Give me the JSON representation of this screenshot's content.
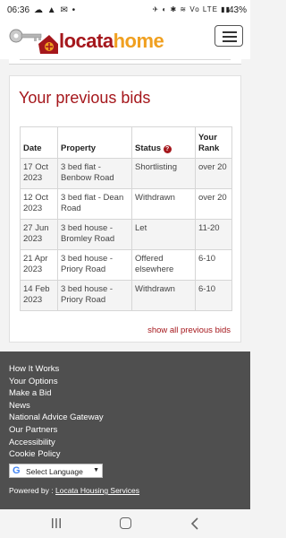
{
  "statusbar": {
    "time": "06:36",
    "notifications": "☁ ▲ ✉ •",
    "system_icons": "✈ ◐ ✱ ≋ Vo LTE ▮▮",
    "battery": "43%"
  },
  "header": {
    "logo_text_part1": "locata",
    "logo_text_part2": "home",
    "menu_icon": "hamburger-icon",
    "brand_color": "#a5171c",
    "brand_accent": "#f0a020"
  },
  "bids": {
    "title": "Your previous bids",
    "columns": {
      "date": "Date",
      "property": "Property",
      "status": "Status",
      "rank_line1": "Your",
      "rank_line2": "Rank"
    },
    "status_help_icon": "?",
    "rows": [
      {
        "date": "17 Oct 2023",
        "property": "3 bed flat - Benbow Road",
        "status": "Shortlisting",
        "rank": "over 20"
      },
      {
        "date": "12 Oct 2023",
        "property": "3 bed flat - Dean Road",
        "status": "Withdrawn",
        "rank": "over 20"
      },
      {
        "date": "27 Jun 2023",
        "property": "3 bed house - Bromley Road",
        "status": "Let",
        "rank": "11-20"
      },
      {
        "date": "21 Apr 2023",
        "property": "3 bed house - Priory Road",
        "status": "Offered elsewhere",
        "rank": "6-10"
      },
      {
        "date": "14 Feb 2023",
        "property": "3 bed house - Priory Road",
        "status": "Withdrawn",
        "rank": "6-10"
      }
    ],
    "show_all_label": "show all previous bids"
  },
  "footer": {
    "links": [
      "How It Works",
      "Your Options",
      "Make a Bid",
      "News",
      "National Advice Gateway",
      "Our Partners",
      "Accessibility",
      "Cookie Policy"
    ],
    "language_label": "Select Language",
    "google_glyph": "G",
    "powered_prefix": "Powered by : ",
    "powered_link": "Locata Housing Services"
  },
  "navbar": {
    "recent_icon": "recent-apps-icon",
    "home_icon": "home-icon",
    "back_icon": "back-icon"
  }
}
